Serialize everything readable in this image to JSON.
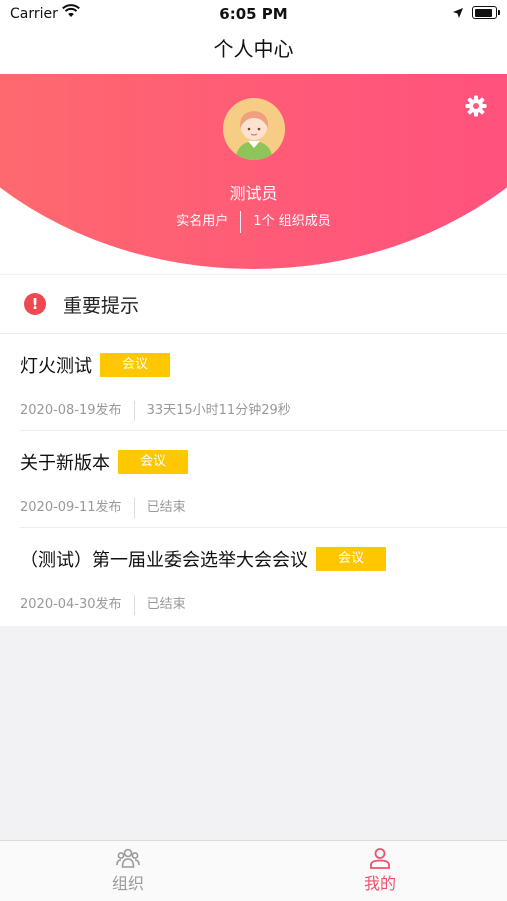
{
  "status_bar": {
    "carrier": "Carrier",
    "time": "6:05 PM"
  },
  "nav": {
    "title": "个人中心"
  },
  "profile": {
    "name": "测试员",
    "verified": "实名用户",
    "orgs": "1个 组织成员",
    "gradient_colors": [
      "#fd6f6a",
      "#ff4d80"
    ]
  },
  "notice": {
    "title": "重要提示",
    "items": [
      {
        "title": "灯火测试",
        "tag": "会议",
        "date": "2020-08-19发布",
        "status": "33天15小时11分钟29秒"
      },
      {
        "title": "关于新版本",
        "tag": "会议",
        "date": "2020-09-11发布",
        "status": "已结束"
      },
      {
        "title": "（测试）第一届业委会选举大会会议",
        "tag": "会议",
        "date": "2020-04-30发布",
        "status": "已结束"
      }
    ]
  },
  "tabs": [
    {
      "label": "组织",
      "icon": "org-icon",
      "active": false
    },
    {
      "label": "我的",
      "icon": "person-icon",
      "active": true
    }
  ],
  "colors": {
    "tag": "#fec700",
    "active_tab": "#f0506e",
    "alert": "#ee4850"
  }
}
